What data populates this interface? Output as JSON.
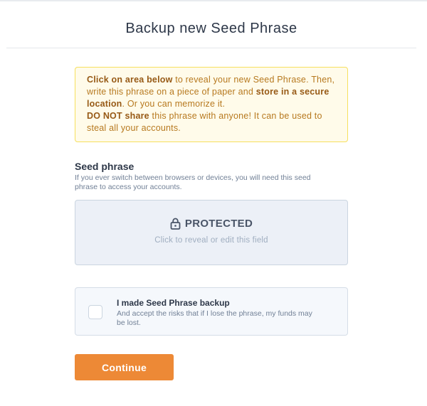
{
  "page": {
    "title": "Backup new Seed Phrase"
  },
  "warning": {
    "line1_bold": "Click on area below",
    "line1_rest": " to reveal your new Seed Phrase.",
    "line2_text": "Then, write this phrase on a piece of paper and ",
    "line2_bold": "store in a secure location",
    "line2_rest": ". Or you can memorize it.",
    "line3_bold": "DO NOT share",
    "line3_rest": " this phrase with anyone! It can be used to steal all your accounts."
  },
  "seed_section": {
    "label": "Seed phrase",
    "description": "If you ever switch between browsers or devices, you will need this seed phrase to access your accounts."
  },
  "protected_field": {
    "title": "PROTECTED",
    "subtitle": "Click to reveal or edit this field",
    "icon": "lock-icon"
  },
  "backup_confirm": {
    "checked": false,
    "title": "I made Seed Phrase backup",
    "description": "And accept the risks that if I lose the phrase, my funds may be lost."
  },
  "actions": {
    "continue_label": "Continue"
  },
  "colors": {
    "accent": "#ed8936",
    "warning_bg": "#fffbea",
    "warning_border": "#f6e05e",
    "warning_text": "#b7791f"
  }
}
